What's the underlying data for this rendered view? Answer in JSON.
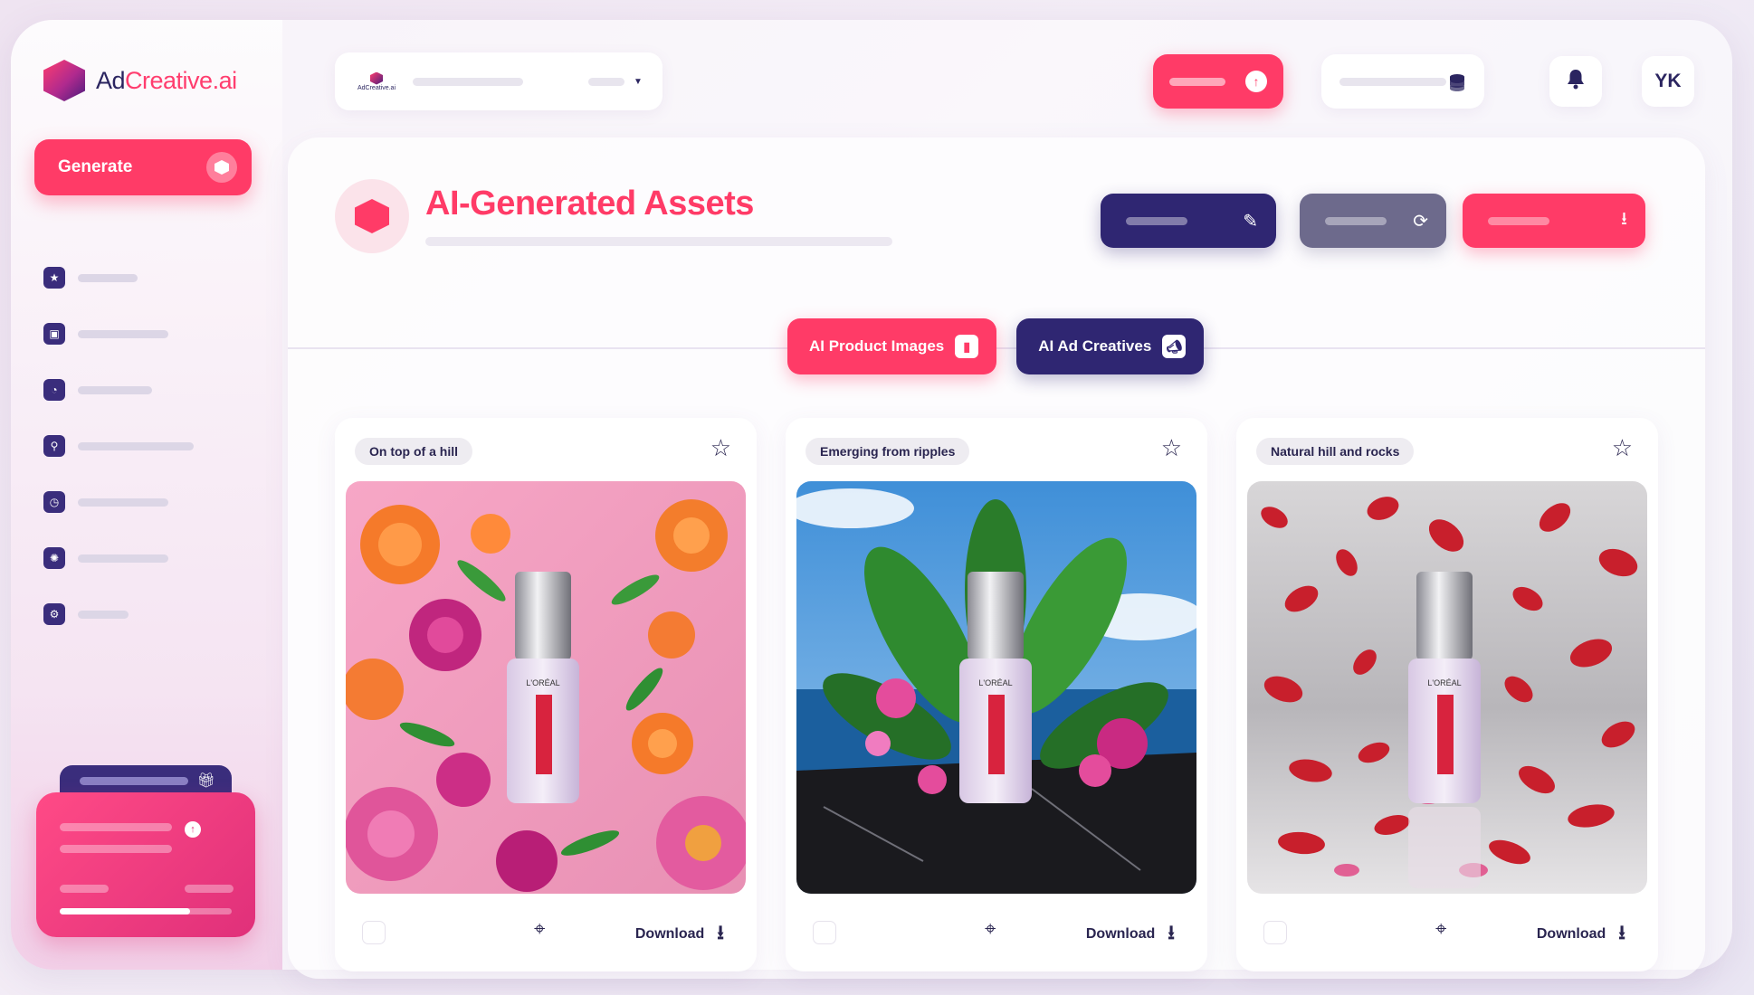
{
  "brand": {
    "name_part1": "Ad",
    "name_part2": "Creative",
    "name_part3": ".ai",
    "mini_logo_text": "AdCreative.ai"
  },
  "sidebar": {
    "generate_label": "Generate",
    "nav_items": [
      {
        "icon": "star-icon",
        "bar_width": 66
      },
      {
        "icon": "box-icon",
        "bar_width": 100
      },
      {
        "icon": "gauge-icon",
        "bar_width": 82
      },
      {
        "icon": "search-icon",
        "bar_width": 128
      },
      {
        "icon": "clock-icon",
        "bar_width": 100
      },
      {
        "icon": "bulb-icon",
        "bar_width": 100
      },
      {
        "icon": "settings-icon",
        "bar_width": 56
      }
    ],
    "promo_progress": 0.76
  },
  "topbar": {
    "avatar_initials": "YK"
  },
  "main": {
    "title": "AI-Generated Assets",
    "tabs": [
      {
        "label": "AI Product Images"
      },
      {
        "label": "AI Ad Creatives"
      }
    ]
  },
  "cards": [
    {
      "label": "On top of a hill",
      "download_label": "Download",
      "scene": "paper-flowers"
    },
    {
      "label": "Emerging from ripples",
      "download_label": "Download",
      "scene": "tropical-leaves"
    },
    {
      "label": "Natural hill and rocks",
      "download_label": "Download",
      "scene": "rose-petals"
    }
  ],
  "colors": {
    "accent": "#ff3b67",
    "navy": "#2f2672",
    "grey": "#6d6a8c"
  }
}
